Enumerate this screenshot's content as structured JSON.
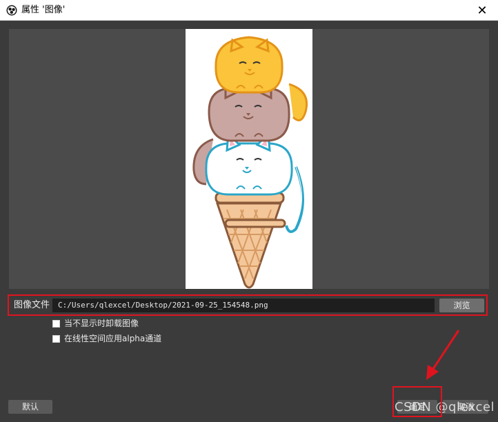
{
  "window": {
    "title": "属性 '图像'",
    "app_icon": "obs-logo-icon",
    "close_icon": "close-icon"
  },
  "form": {
    "image_file_label": "图像文件",
    "image_file_path": "C:/Users/qlexcel/Desktop/2021-09-25_154548.png",
    "browse_label": "浏览",
    "unload_when_hidden_label": "当不显示时卸载图像",
    "unload_when_hidden_checked": false,
    "linear_alpha_label": "在线性空间应用alpha通道",
    "linear_alpha_checked": false
  },
  "buttons": {
    "defaults_label": "默认",
    "ok_label": "确定",
    "cancel_label": "取消"
  },
  "watermark": "CSDN @qlexcel",
  "colors": {
    "highlight": "#e0141e",
    "dialog_bg": "#3b3b3b",
    "preview_bg": "#4b4b4b"
  }
}
